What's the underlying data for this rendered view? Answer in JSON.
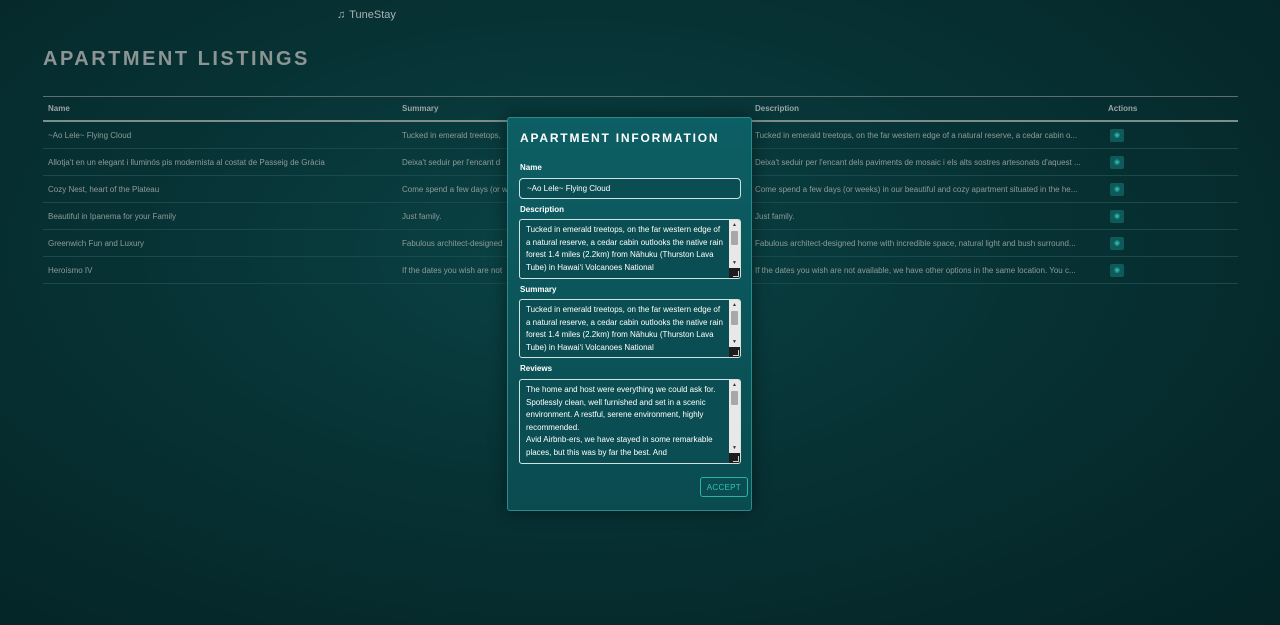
{
  "app": {
    "brand_name": "TuneStay",
    "brand_icon": "music-note-icon"
  },
  "page": {
    "title": "APARTMENT LISTINGS"
  },
  "table": {
    "columns": [
      "Name",
      "Summary",
      "Description",
      "Actions"
    ],
    "rows": [
      {
        "name": "~Ao Lele~ Flying Cloud",
        "summary": "Tucked in emerald treetops,",
        "description": "Tucked in emerald treetops, on the far western edge of a natural reserve, a cedar cabin o..."
      },
      {
        "name": "Allotja't en un elegant i lluminós pis modernista al costat de Passeig de Gràcia",
        "summary": "Deixa't seduir per l'encant d",
        "description": "Deixa't seduir per l'encant dels paviments de mosaic i els alts sostres artesonats d'aquest ..."
      },
      {
        "name": "Cozy Nest, heart of the Plateau",
        "summary": "Come spend a few days (or w",
        "description": "Come spend a few days (or weeks) in our beautiful and cozy apartment situated in the he..."
      },
      {
        "name": "Beautiful in Ipanema for your Family",
        "summary": "Just family.",
        "description": "Just family."
      },
      {
        "name": "Greenwich Fun and Luxury",
        "summary": "Fabulous architect-designed",
        "description": "Fabulous architect-designed home with incredible space, natural light and bush surround..."
      },
      {
        "name": "Heroísmo IV",
        "summary": "If the dates you wish are not",
        "description": "If the dates you wish are not available, we have other options in the same location. You c..."
      }
    ],
    "action_icon": "eye-icon"
  },
  "modal": {
    "title": "APARTMENT INFORMATION",
    "name_label": "Name",
    "name_value": "~Ao Lele~ Flying Cloud",
    "description_label": "Description",
    "description_value": "Tucked in emerald treetops, on the far western edge of a natural reserve, a cedar cabin outlooks the native rain forest 1.4 miles (2.2km) from Nāhuku (Thurston Lava Tube) in Hawaiʻi Volcanoes National",
    "summary_label": "Summary",
    "summary_value": "Tucked in emerald treetops, on the far western edge of a natural reserve, a cedar cabin outlooks the native rain forest 1.4 miles (2.2km) from Nāhuku (Thurston Lava Tube) in Hawaiʻi Volcanoes National",
    "reviews_label": "Reviews",
    "reviews_value": "The home and host were everything we could ask for. Spotlessly clean, well furnished and set in a scenic environment. A restful, serene environment, highly recommended.\nAvid Airbnb-ers, we have stayed in some remarkable places, but this was by far the best. And",
    "accept_label": "ACCEPT"
  }
}
